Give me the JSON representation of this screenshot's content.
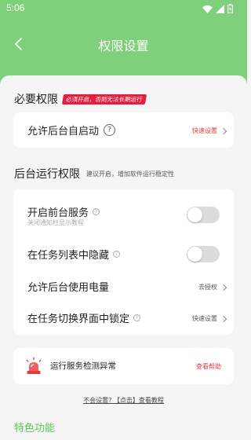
{
  "status_bar": {
    "time": "5:06"
  },
  "app_bar": {
    "title": "权限设置"
  },
  "required_section": {
    "title": "必要权限",
    "badge": "必须开启，否则无法长期运行",
    "item": {
      "label": "允许后台自启动",
      "action": "快速设置"
    }
  },
  "background_section": {
    "title": "后台运行权限",
    "subtitle": "建议开启，增加软件运行稳定性",
    "items": [
      {
        "label": "开启前台服务",
        "hint": "关闭通知栏显示教程",
        "toggle_on": false
      },
      {
        "label": "在任务列表中隐藏",
        "toggle_on": false
      },
      {
        "label": "允许后台使用电量",
        "action": "去授权"
      },
      {
        "label": "在任务切换界面中锁定",
        "action": "快速设置"
      }
    ]
  },
  "alert_card": {
    "label": "运行服务检测异常",
    "action": "查看帮助"
  },
  "help_link": "不会设置? 【点击】查看教程",
  "features_title": "特色功能",
  "colors": {
    "accent_green": "#7ed07a",
    "badge_red": "#e41e3f",
    "alert_red": "#e23b3b"
  }
}
